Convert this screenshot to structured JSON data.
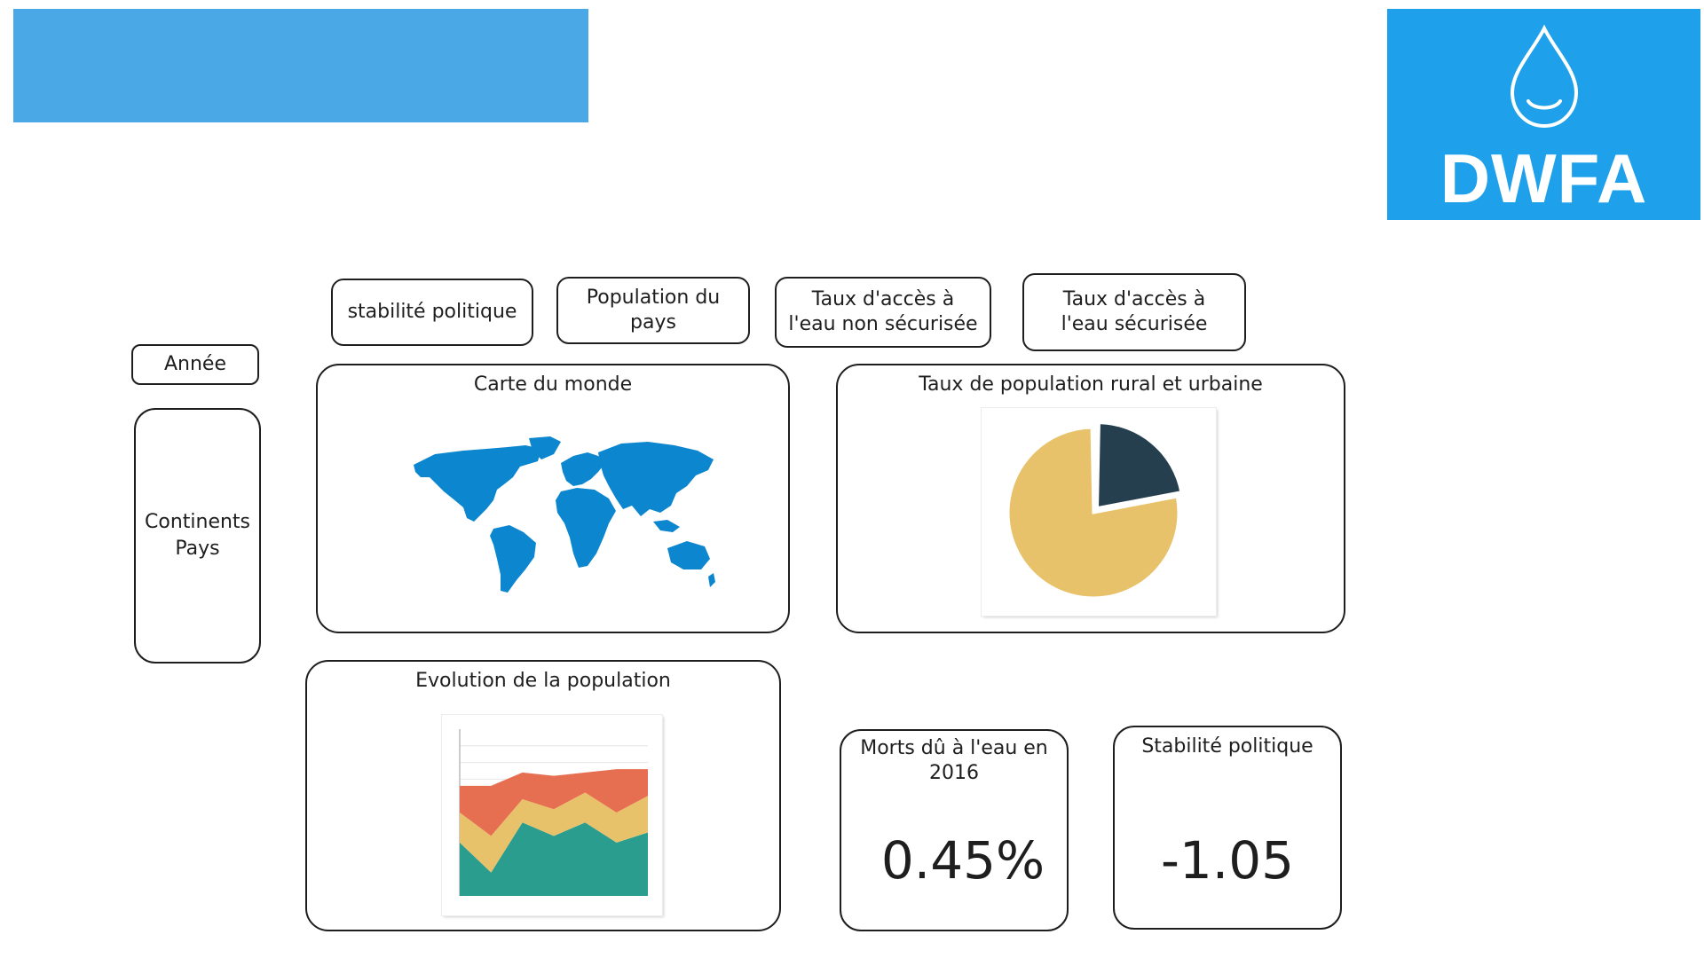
{
  "logo": {
    "text": "DWFA",
    "icon": "water-drop-icon",
    "color": "#1ea1ea"
  },
  "banner": {
    "color": "#4aa8e6"
  },
  "filters": {
    "stability": "stabilité politique",
    "population_line1": "Population du",
    "population_line2": "pays",
    "unsafe_line1": "Taux d'accès à",
    "unsafe_line2": "l'eau non sécurisée",
    "safe_line1": "Taux d'accès à",
    "safe_line2": "l'eau sécurisée",
    "year": "Année",
    "continents": "Continents",
    "countries": "Pays"
  },
  "panels": {
    "map_title": "Carte du monde",
    "pie_title": "Taux de population rural et urbaine",
    "evolution_title": "Evolution de la population"
  },
  "kpis": {
    "deaths_title_line1": "Morts dû à l'eau en",
    "deaths_title_line2": "2016",
    "deaths_value": "0.45%",
    "stability_title": "Stabilité politique",
    "stability_value": "-1.05"
  },
  "chart_data": [
    {
      "type": "pie",
      "slices": [
        {
          "value": 78,
          "color": "#e8c26a"
        },
        {
          "value": 22,
          "color": "#253f4f"
        }
      ]
    },
    {
      "type": "area",
      "stacked": true,
      "x": [
        0,
        1,
        2,
        3,
        4,
        5,
        6
      ],
      "ylim": [
        0,
        10
      ],
      "series": [
        {
          "color": "#2a9d8f",
          "values": [
            3.2,
            1.4,
            4.4,
            3.6,
            4.4,
            3.2,
            3.8
          ]
        },
        {
          "color": "#e8c26a",
          "values": [
            1.8,
            2.2,
            1.4,
            1.6,
            1.8,
            1.8,
            2.2
          ]
        },
        {
          "color": "#e76f51",
          "values": [
            1.6,
            3.0,
            1.6,
            2.0,
            1.2,
            2.6,
            1.6
          ]
        }
      ],
      "grid": true
    }
  ]
}
